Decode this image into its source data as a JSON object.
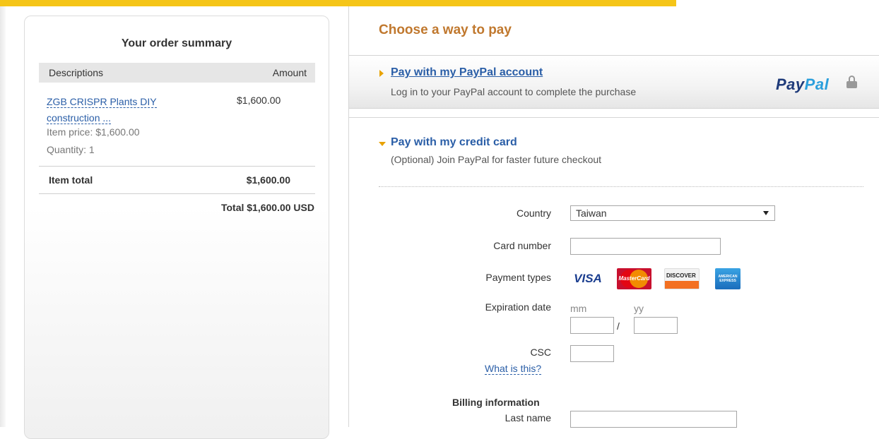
{
  "summary": {
    "title": "Your order summary",
    "col_description": "Descriptions",
    "col_amount": "Amount",
    "item_name_line1": "ZGB CRISPR Plants DIY",
    "item_name_line2": "construction ...",
    "item_amount": "$1,600.00",
    "item_price": "Item price: $1,600.00",
    "item_quantity": "Quantity: 1",
    "item_total_label": "Item total",
    "item_total_amount": "$1,600.00",
    "grand_total": "Total $1,600.00 USD"
  },
  "payment": {
    "heading": "Choose a way to pay",
    "paypal_option": {
      "title": "Pay with my PayPal account",
      "subtitle": "Log in to your PayPal account to complete the purchase",
      "logo_part1": "Pay",
      "logo_part2": "Pal"
    },
    "card_option": {
      "title": "Pay with my credit card",
      "subtitle": "(Optional) Join PayPal for faster future checkout"
    },
    "form": {
      "country_label": "Country",
      "country_value": "Taiwan",
      "card_number_label": "Card number",
      "card_number_value": "",
      "payment_types_label": "Payment types",
      "card_types": [
        "VISA",
        "MasterCard",
        "DISCOVER",
        "AMERICAN EXPRESS"
      ],
      "expiration_label": "Expiration date",
      "mm_label": "mm",
      "yy_label": "yy",
      "slash": "/",
      "csc_label": "CSC",
      "csc_help_link": "What is this?",
      "billing_heading": "Billing information",
      "last_name_label": "Last name"
    }
  },
  "colors": {
    "top_bar": "#f5c518",
    "heading_orange": "#c0782e",
    "link_blue": "#2a5ea7",
    "arrow_gold": "#e8a200"
  }
}
